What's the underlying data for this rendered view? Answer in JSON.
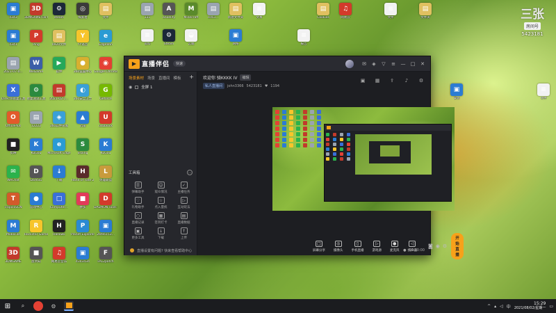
{
  "desktop": {
    "icons": [
      {
        "label": "4343",
        "color": "#2b7cd3",
        "glyph": "▣"
      },
      {
        "label": "3DMGAME-Far.Cry.5",
        "color": "#c23a2b",
        "glyph": "3D"
      },
      {
        "label": "steam",
        "color": "#1b2838",
        "glyph": "⚙"
      },
      {
        "label": "探索者",
        "color": "#3a3a3a",
        "glyph": "◎"
      },
      {
        "label": "文件",
        "color": "#e0c060",
        "glyph": "▤"
      },
      {
        "label": "4341",
        "color": "#2b7cd3",
        "glyph": "▣"
      },
      {
        "label": "Ping",
        "color": "#d33a2b",
        "glyph": "P"
      },
      {
        "label": "0920文件",
        "color": "#e0c060",
        "glyph": "▤"
      },
      {
        "label": "YY语音",
        "color": "#f7c52b",
        "glyph": "Y"
      },
      {
        "label": "EdgeWin",
        "color": "#2a9bd3",
        "glyph": "e"
      },
      {
        "label": "2021-07-0...",
        "color": "#9aa4b0",
        "glyph": "▤"
      },
      {
        "label": "WeGame",
        "color": "#3b5ea8",
        "glyph": "W"
      },
      {
        "label": "软件",
        "color": "#25a85a",
        "glyph": "▶"
      },
      {
        "label": "360设置中心",
        "color": "#d8b030",
        "glyph": "●"
      },
      {
        "label": "Google Chrome",
        "color": "#e44134",
        "glyph": "◉"
      },
      {
        "label": "DirectX修复工具",
        "color": "#3a6fd8",
        "glyph": "X"
      },
      {
        "label": "修复测试工具",
        "color": "#2b8a3e",
        "glyph": "⚙"
      },
      {
        "label": "2021-02-1...",
        "color": "#c23a2b",
        "glyph": "▤"
      },
      {
        "label": "360安全卫士",
        "color": "#3aa0d8",
        "glyph": "◐"
      },
      {
        "label": "Geforce",
        "color": "#76b900",
        "glyph": "G"
      },
      {
        "label": "OfficePlus",
        "color": "#e25a2b",
        "glyph": "O"
      },
      {
        "label": "12222",
        "color": "#9aa4b0",
        "glyph": "▤"
      },
      {
        "label": "360软件管家",
        "color": "#3aa0d8",
        "glyph": "◈"
      },
      {
        "label": "迅雷",
        "color": "#2b7cd3",
        "glyph": "▲"
      },
      {
        "label": "usbblock",
        "color": "#d33a2b",
        "glyph": "U"
      },
      {
        "label": "剪映",
        "color": "#222222",
        "glyph": "■"
      },
      {
        "label": "KuGou",
        "color": "#2b7cd3",
        "glyph": "K"
      },
      {
        "label": "Microsoft Edge",
        "color": "#2a9bd3",
        "glyph": "e"
      },
      {
        "label": "Ssaing",
        "color": "#2b8a3e",
        "glyph": "S"
      },
      {
        "label": "KuGou",
        "color": "#2b7cd3",
        "glyph": "K"
      },
      {
        "label": "WeChat",
        "color": "#2bb24c",
        "glyph": "✉"
      },
      {
        "label": "DarkSG",
        "color": "#555555",
        "glyph": "D"
      },
      {
        "label": "下载",
        "color": "#2b7cd3",
        "glyph": "↓"
      },
      {
        "label": "Hand of Fate 2",
        "color": "#5a2b2b",
        "glyph": "H"
      },
      {
        "label": "英雄联盟",
        "color": "#c89b3c",
        "glyph": "L"
      },
      {
        "label": "TropicoSCN",
        "color": "#d35a2b",
        "glyph": "T"
      },
      {
        "label": "游戏中心",
        "color": "#2b7cd3",
        "glyph": "●"
      },
      {
        "label": "Computer...",
        "color": "#3a6fd8",
        "glyph": "□"
      },
      {
        "label": "拼多",
        "color": "#e23a5a",
        "glyph": "■"
      },
      {
        "label": "DAEMON Tools Lite",
        "color": "#d33a2b",
        "glyph": "D"
      },
      {
        "label": "MobaFile",
        "color": "#2b7cd3",
        "glyph": "M"
      },
      {
        "label": "Rockstar Games",
        "color": "#f7c52b",
        "glyph": "R"
      },
      {
        "label": "Hallowk",
        "color": "#222222",
        "glyph": "H"
      },
      {
        "label": "Planet Explorers",
        "color": "#2b8ad3",
        "glyph": "P"
      },
      {
        "label": "2bfeb153...",
        "color": "#2b7cd3",
        "glyph": "▣"
      },
      {
        "label": "3DMGAME",
        "color": "#c23a2b",
        "glyph": "3D"
      },
      {
        "label": "废所知",
        "color": "#555555",
        "glyph": "■"
      },
      {
        "label": "网易云音乐",
        "color": "#d33a2b",
        "glyph": "♫"
      },
      {
        "label": "4343434",
        "color": "#2b7cd3",
        "glyph": "▣"
      },
      {
        "label": "FAL2patch",
        "color": "#555555",
        "glyph": "F"
      },
      {
        "label": "331",
        "color": "#9aa4b0",
        "glyph": "▤"
      },
      {
        "label": "anoelity",
        "color": "#555555",
        "glyph": "A"
      },
      {
        "label": "Minecraft",
        "color": "#5a8a2b",
        "glyph": "M"
      },
      {
        "label": "ed51...",
        "color": "#9aa4b0",
        "glyph": "▤"
      },
      {
        "label": "新建文件夹",
        "color": "#e0c060",
        "glyph": "▤"
      },
      {
        "label": "文本",
        "color": "#f2f2f2",
        "glyph": "≡"
      },
      {
        "label": "Cookies",
        "color": "#e0c060",
        "glyph": "▤"
      },
      {
        "label": "网易云",
        "color": "#d33a2b",
        "glyph": "♫"
      },
      {
        "label": "文件",
        "color": "#f2f2f2",
        "glyph": "≡"
      },
      {
        "label": "文件夹",
        "color": "#e0c060",
        "glyph": "▤"
      },
      {
        "label": "资料",
        "color": "#f2f2f2",
        "glyph": "≡"
      },
      {
        "label": "Steam",
        "color": "#1b2838",
        "glyph": "⚙"
      },
      {
        "label": "云端",
        "color": "#f2f2f2",
        "glyph": "◒"
      },
      {
        "label": "网络",
        "color": "#2b7cd3",
        "glyph": "▣"
      },
      {
        "label": "报告",
        "color": "#f2f2f2",
        "glyph": "≡"
      },
      {
        "label": "安装",
        "color": "#2b7cd3",
        "glyph": "▣"
      },
      {
        "label": "文件",
        "color": "#f2f2f2",
        "glyph": "≡"
      }
    ],
    "top_right": {
      "big_text": "三张",
      "tag": "房间号",
      "room_number": "5423181"
    }
  },
  "app": {
    "title": "直播伴侣",
    "version_badge": "快速",
    "left_tabs": [
      "场景素材",
      "场景",
      "直播间",
      "模板"
    ],
    "scene_item": "全屏 1",
    "tools_header": "工具箱",
    "tools": [
      {
        "label": "弹幕助手",
        "glyph": "☰"
      },
      {
        "label": "观众情况",
        "glyph": "☺"
      },
      {
        "label": "主播任务",
        "glyph": "✓"
      },
      {
        "label": "礼物助手",
        "glyph": "♡"
      },
      {
        "label": "点入量统",
        "glyph": "☆"
      },
      {
        "label": "互动玩法",
        "glyph": "▷"
      },
      {
        "label": "直播记录",
        "glyph": "○"
      },
      {
        "label": "签到打卡",
        "glyph": "▦"
      },
      {
        "label": "直播数据",
        "glyph": "▤"
      },
      {
        "label": "更多工具",
        "glyph": "▣"
      },
      {
        "label": "下载",
        "glyph": "↓"
      },
      {
        "label": "上传",
        "glyph": "↑"
      }
    ],
    "welcome": "欢迎你 骑KKKK IV",
    "edit_label": "编辑",
    "sub_info": {
      "category": "私人直播间",
      "user": "john3366",
      "room": "5423181",
      "fans": "1194"
    },
    "bottom_controls": [
      {
        "label": "屏幕分享",
        "glyph": "□"
      },
      {
        "label": "摄像头",
        "glyph": "◎"
      },
      {
        "label": "手机直播",
        "glyph": "▯"
      },
      {
        "label": "游戏源",
        "glyph": "▷"
      },
      {
        "label": "麦克风",
        "glyph": "●"
      },
      {
        "label": "扬声器",
        "glyph": "◁"
      }
    ],
    "start_button": "开始直播",
    "status_message": "直播设置有问题? 快来查看帮助中心",
    "timer": "00:00:00"
  },
  "taskbar": {
    "time": "15:29",
    "date": "2021/08/02/星期一"
  }
}
